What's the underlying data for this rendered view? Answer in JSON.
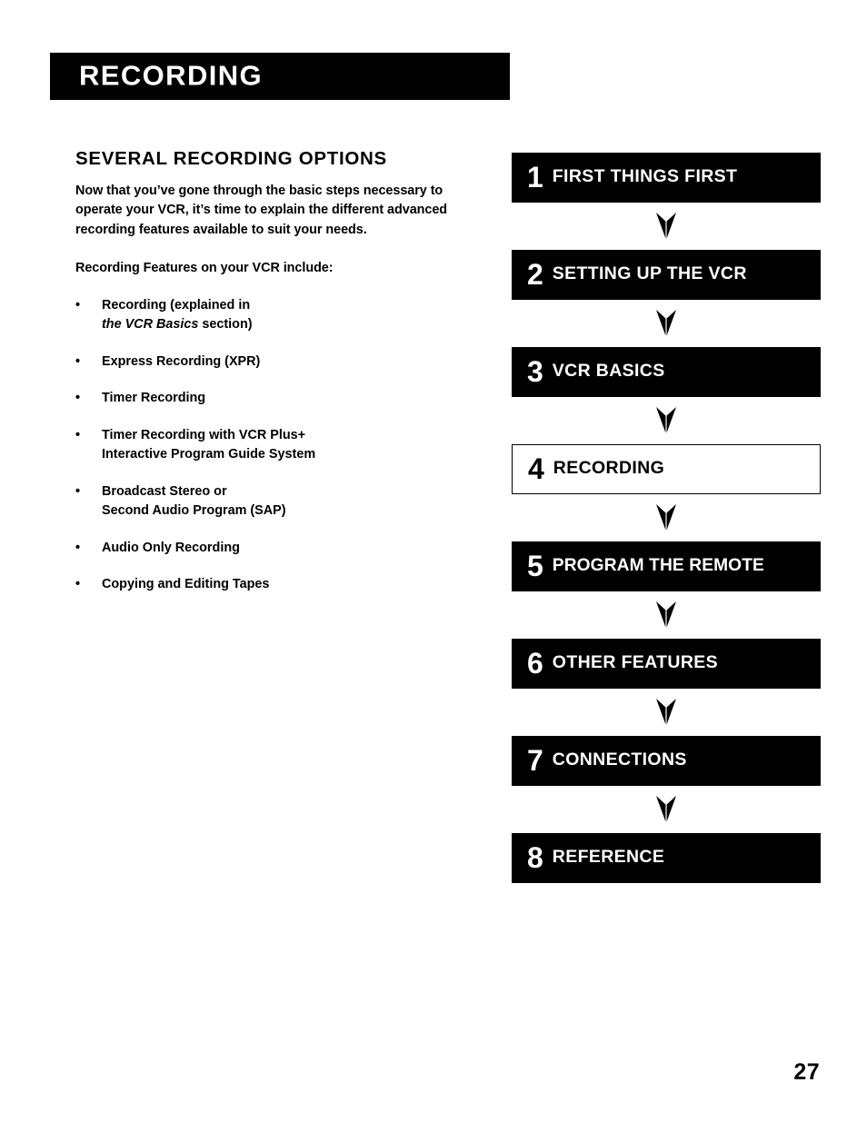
{
  "banner": {
    "title": "RECORDING"
  },
  "left_column": {
    "heading": "SEVERAL RECORDING OPTIONS",
    "intro_paragraph": "Now that you’ve gone through the basic steps necessary to operate your VCR, it’s time to explain the different advanced recording features available to suit your needs.",
    "features_lead": "Recording Features on your VCR include:",
    "features": [
      {
        "bullet": "•",
        "line1": "Recording (explained in",
        "line2_italic": "the VCR Basics",
        "line2_roman": " section)"
      },
      {
        "bullet": "•",
        "line1": "Express Recording (XPR)",
        "line2_italic": "",
        "line2_roman": ""
      },
      {
        "bullet": "•",
        "line1": "Timer Recording",
        "line2_italic": "",
        "line2_roman": ""
      },
      {
        "bullet": "•",
        "line1": "Timer Recording with VCR Plus+",
        "line2_italic": "",
        "line2_roman": "Interactive Program Guide System"
      },
      {
        "bullet": "•",
        "line1": "Broadcast Stereo or",
        "line2_italic": "",
        "line2_roman": "Second Audio Program (SAP)"
      },
      {
        "bullet": "•",
        "line1": "Audio Only Recording",
        "line2_italic": "",
        "line2_roman": ""
      },
      {
        "bullet": "•",
        "line1": "Copying and Editing Tapes",
        "line2_italic": "",
        "line2_roman": ""
      }
    ]
  },
  "flow_chart": {
    "arrow_icon": "chevron-down-arrow",
    "steps": [
      {
        "number": "1",
        "label": "FIRST THINGS FIRST",
        "current": false
      },
      {
        "number": "2",
        "label": "SETTING UP THE VCR",
        "current": false
      },
      {
        "number": "3",
        "label": "VCR BASICS",
        "current": false
      },
      {
        "number": "4",
        "label": "RECORDING",
        "current": true
      },
      {
        "number": "5",
        "label": "PROGRAM THE REMOTE",
        "current": false
      },
      {
        "number": "6",
        "label": "OTHER FEATURES",
        "current": false
      },
      {
        "number": "7",
        "label": "CONNECTIONS",
        "current": false
      },
      {
        "number": "8",
        "label": "REFERENCE",
        "current": false
      }
    ]
  },
  "footer": {
    "page_number": "27"
  },
  "colors": {
    "ink": "#000000",
    "paper": "#ffffff"
  }
}
